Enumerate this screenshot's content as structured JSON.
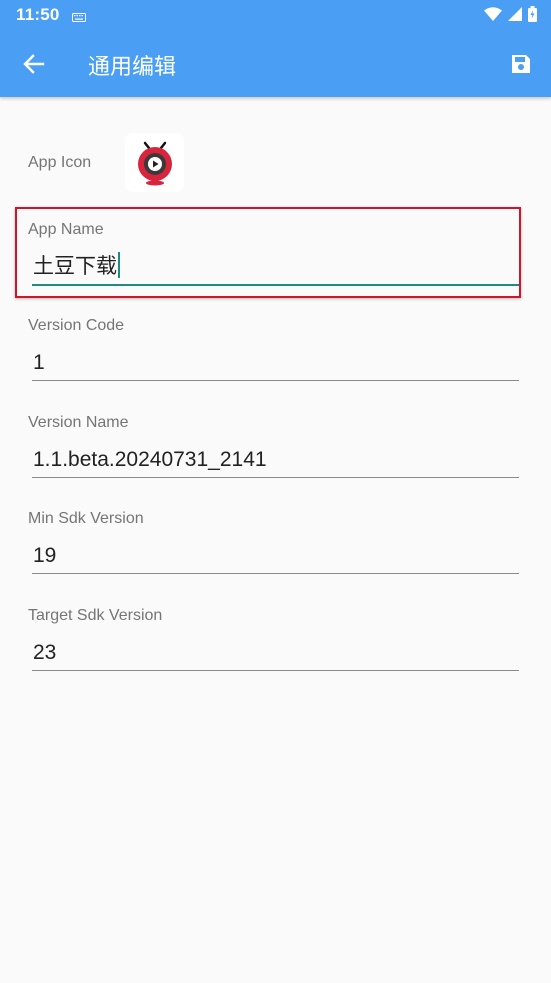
{
  "status_bar": {
    "time": "11:50"
  },
  "app_bar": {
    "title": "通用编辑"
  },
  "app_icon": {
    "label": "App Icon"
  },
  "fields": [
    {
      "label": "App Name",
      "value": "土豆下载"
    },
    {
      "label": "Version Code",
      "value": "1"
    },
    {
      "label": "Version Name",
      "value": "1.1.beta.20240731_2141"
    },
    {
      "label": "Min Sdk Version",
      "value": "19"
    },
    {
      "label": "Target Sdk Version",
      "value": "23"
    }
  ],
  "colors": {
    "primary": "#4a9ff5",
    "accent": "#1e8a84",
    "highlight_border": "#d0152a",
    "icon_red": "#d8243c"
  },
  "icons": [
    "keyboard-icon",
    "wifi-icon",
    "signal-icon",
    "battery-icon",
    "back-arrow-icon",
    "save-icon",
    "app-icon"
  ]
}
